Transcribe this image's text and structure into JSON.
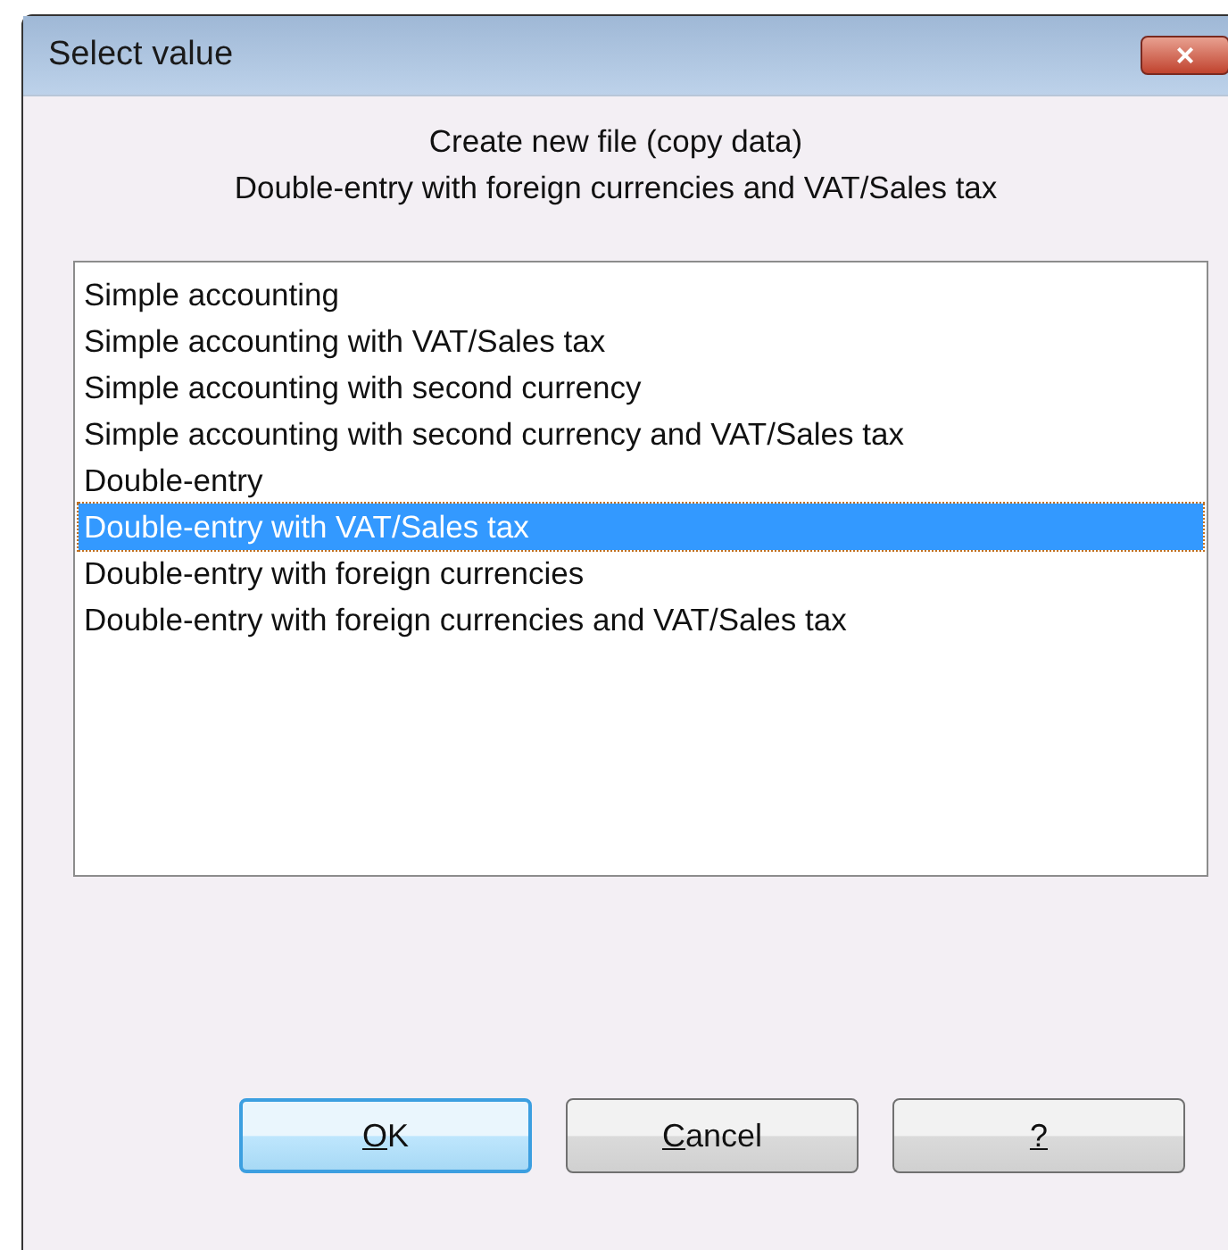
{
  "window": {
    "title": "Select value",
    "close": "×"
  },
  "header": [
    "Create new file (copy data)",
    "Double-entry with foreign currencies and VAT/Sales tax"
  ],
  "list": [
    {
      "label": "Simple accounting",
      "selected": false
    },
    {
      "label": "Simple accounting with VAT/Sales tax",
      "selected": false
    },
    {
      "label": "Simple accounting with second currency",
      "selected": false
    },
    {
      "label": "Simple accounting with second currency and VAT/Sales tax",
      "selected": false
    },
    {
      "label": "Double-entry",
      "selected": false
    },
    {
      "label": "Double-entry with VAT/Sales tax",
      "selected": true
    },
    {
      "label": "Double-entry with foreign currencies",
      "selected": false
    },
    {
      "label": "Double-entry with foreign currencies and VAT/Sales tax",
      "selected": false
    }
  ],
  "buttons": [
    {
      "label": "OK",
      "default": true,
      "mnemonic": true
    },
    {
      "label": "Cancel",
      "default": false,
      "mnemonic": true
    },
    {
      "label": "?",
      "default": false,
      "mnemonic": true
    }
  ]
}
